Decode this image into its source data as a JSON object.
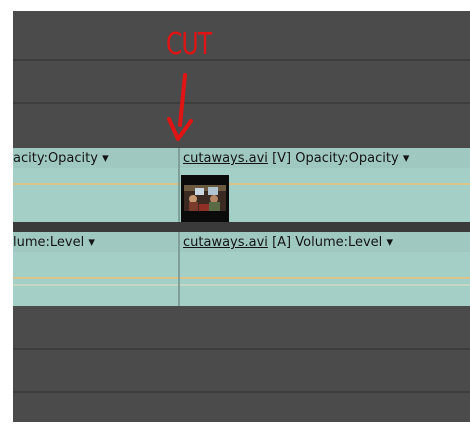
{
  "annotation": {
    "cut_label": "CUT",
    "arrow_color": "#e01414"
  },
  "video_track": {
    "left_clip_label": "acity:Opacity",
    "right_clip_name": "cutaways.avi",
    "right_clip_tag": "[V]",
    "right_clip_effect": "Opacity:Opacity",
    "dropdown_glyph": "▾"
  },
  "audio_track": {
    "left_clip_label": "lume:Level",
    "right_clip_name": "cutaways.avi",
    "right_clip_tag": "[A]",
    "right_clip_effect": "Volume:Level",
    "dropdown_glyph": "▾"
  },
  "colors": {
    "clip_fill": "#a4cfc7",
    "keyframe_line": "#d9c58c",
    "track_bg": "#4b4b4b"
  }
}
